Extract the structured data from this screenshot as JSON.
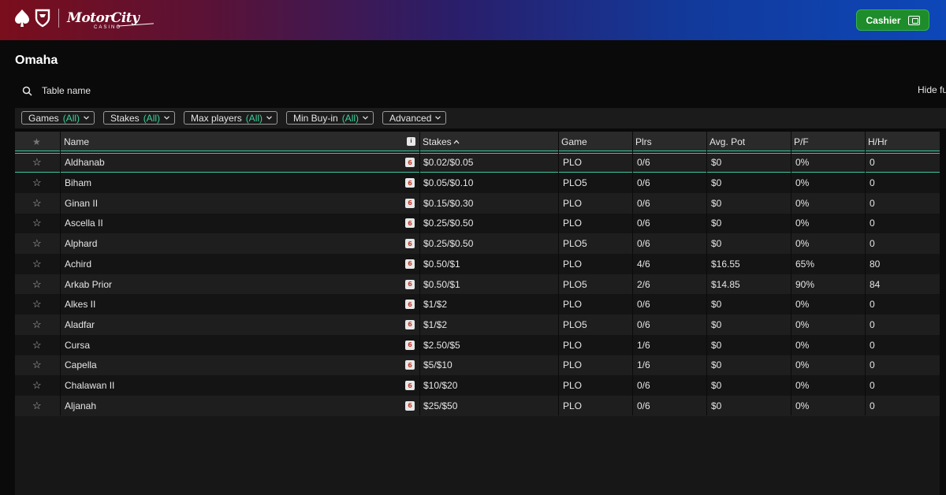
{
  "header": {
    "brand": "MotorCity",
    "brand_sub": "CASINO",
    "cashier_label": "Cashier"
  },
  "page": {
    "title": "Omaha",
    "search_placeholder": "Table name",
    "hide_filters_label": "Hide fu"
  },
  "filters": [
    {
      "label": "Games",
      "value": "(All)"
    },
    {
      "label": "Stakes",
      "value": "(All)"
    },
    {
      "label": "Max players",
      "value": "(All)"
    },
    {
      "label": "Min Buy-in",
      "value": "(All)"
    },
    {
      "label": "Advanced",
      "value": ""
    }
  ],
  "columns": {
    "fav": "★",
    "name": "Name",
    "seats_icon": "i",
    "stakes": "Stakes",
    "sort_indicator": "^",
    "game": "Game",
    "players": "Plrs",
    "avg_pot": "Avg. Pot",
    "pf": "P/F",
    "hhr": "H/Hr"
  },
  "rows": [
    {
      "name": "Aldhanab",
      "seats": "6",
      "stakes": "$0.02/$0.05",
      "game": "PLO",
      "players": "0/6",
      "avg_pot": "$0",
      "pf": "0%",
      "hhr": "0",
      "selected": true
    },
    {
      "name": "Biham",
      "seats": "6",
      "stakes": "$0.05/$0.10",
      "game": "PLO5",
      "players": "0/6",
      "avg_pot": "$0",
      "pf": "0%",
      "hhr": "0"
    },
    {
      "name": "Ginan II",
      "seats": "6",
      "stakes": "$0.15/$0.30",
      "game": "PLO",
      "players": "0/6",
      "avg_pot": "$0",
      "pf": "0%",
      "hhr": "0"
    },
    {
      "name": "Ascella II",
      "seats": "6",
      "stakes": "$0.25/$0.50",
      "game": "PLO",
      "players": "0/6",
      "avg_pot": "$0",
      "pf": "0%",
      "hhr": "0"
    },
    {
      "name": "Alphard",
      "seats": "6",
      "stakes": "$0.25/$0.50",
      "game": "PLO5",
      "players": "0/6",
      "avg_pot": "$0",
      "pf": "0%",
      "hhr": "0"
    },
    {
      "name": "Achird",
      "seats": "6",
      "stakes": "$0.50/$1",
      "game": "PLO",
      "players": "4/6",
      "avg_pot": "$16.55",
      "pf": "65%",
      "hhr": "80"
    },
    {
      "name": "Arkab Prior",
      "seats": "6",
      "stakes": "$0.50/$1",
      "game": "PLO5",
      "players": "2/6",
      "avg_pot": "$14.85",
      "pf": "90%",
      "hhr": "84"
    },
    {
      "name": "Alkes II",
      "seats": "6",
      "stakes": "$1/$2",
      "game": "PLO",
      "players": "0/6",
      "avg_pot": "$0",
      "pf": "0%",
      "hhr": "0"
    },
    {
      "name": "Aladfar",
      "seats": "6",
      "stakes": "$1/$2",
      "game": "PLO5",
      "players": "0/6",
      "avg_pot": "$0",
      "pf": "0%",
      "hhr": "0"
    },
    {
      "name": "Cursa",
      "seats": "6",
      "stakes": "$2.50/$5",
      "game": "PLO",
      "players": "1/6",
      "avg_pot": "$0",
      "pf": "0%",
      "hhr": "0"
    },
    {
      "name": "Capella",
      "seats": "6",
      "stakes": "$5/$10",
      "game": "PLO",
      "players": "1/6",
      "avg_pot": "$0",
      "pf": "0%",
      "hhr": "0"
    },
    {
      "name": "Chalawan II",
      "seats": "6",
      "stakes": "$10/$20",
      "game": "PLO",
      "players": "0/6",
      "avg_pot": "$0",
      "pf": "0%",
      "hhr": "0"
    },
    {
      "name": "Aljanah",
      "seats": "6",
      "stakes": "$25/$50",
      "game": "PLO",
      "players": "0/6",
      "avg_pot": "$0",
      "pf": "0%",
      "hhr": "0"
    }
  ],
  "colors": {
    "accent_teal": "#3fc7a2",
    "filter_all": "#3fcf9a",
    "cashier_green": "#1e8c2b",
    "seat_badge_text": "#c0392b"
  },
  "icons": {
    "logo": "spade-shield-icon",
    "cashier": "wallet-icon",
    "search": "search-icon",
    "favorite": "star-outline-icon"
  }
}
